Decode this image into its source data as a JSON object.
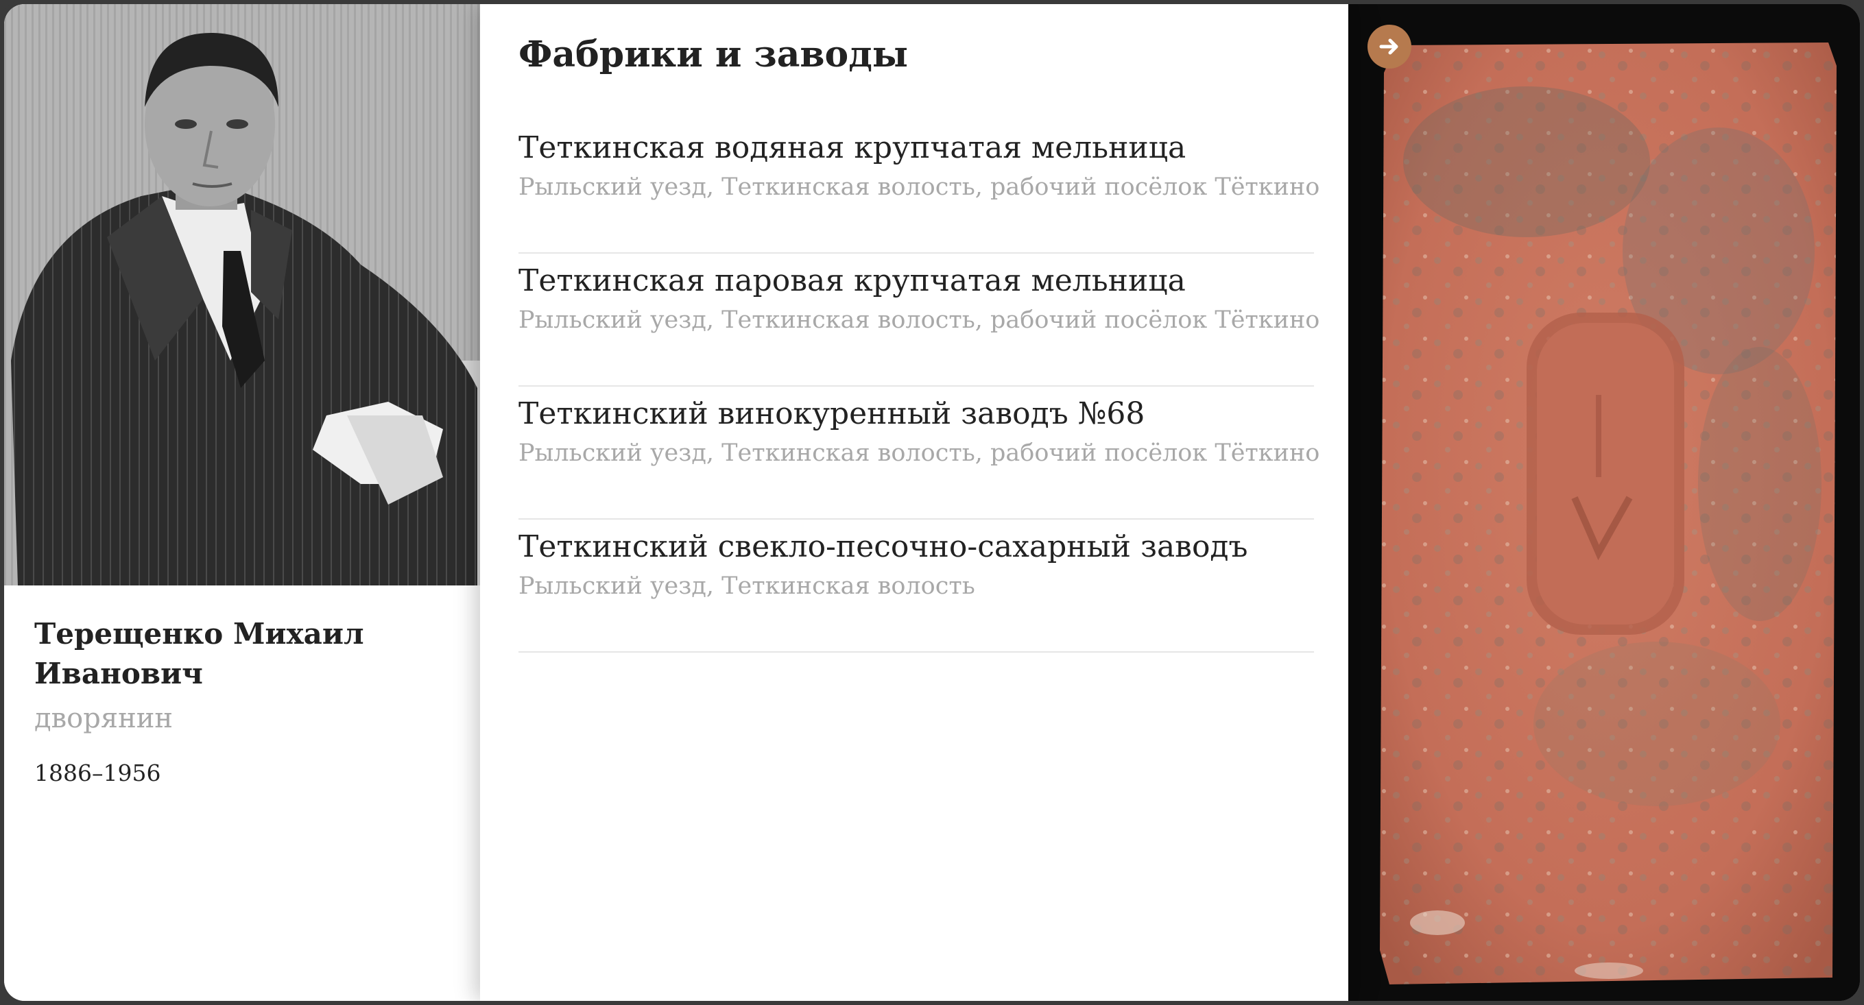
{
  "person": {
    "portrait_alt": "portrait-photo",
    "name": "Терещенко Михаил Иванович",
    "title": "дворянин",
    "years": "1886–1956"
  },
  "factories": {
    "heading": "Фабрики и заводы",
    "items": [
      {
        "name": "Теткинская водяная крупчатая мельница",
        "location": "Рыльский уезд, Теткинская волость, рабочий посёлок Тёткино"
      },
      {
        "name": "Теткинская паровая крупчатая мельница",
        "location": "Рыльский уезд, Теткинская волость, рабочий посёлок Тёткино"
      },
      {
        "name": "Теткинский винокуренный заводъ №68",
        "location": "Рыльский уезд, Теткинская волость, рабочий посёлок Тёткино"
      },
      {
        "name": "Теткинский свекло-песочно-сахарный заводъ",
        "location": "Рыльский уезд, Теткинская волость"
      }
    ]
  },
  "brick_panel": {
    "arrow_icon": "arrow-right-icon",
    "accent_color": "#b67a4e",
    "brick_color": "#c6735d",
    "background_color": "#0b0b0b"
  },
  "colors": {
    "text_primary": "#222222",
    "text_muted": "#a8a8a8",
    "divider": "#e6e6e6"
  }
}
